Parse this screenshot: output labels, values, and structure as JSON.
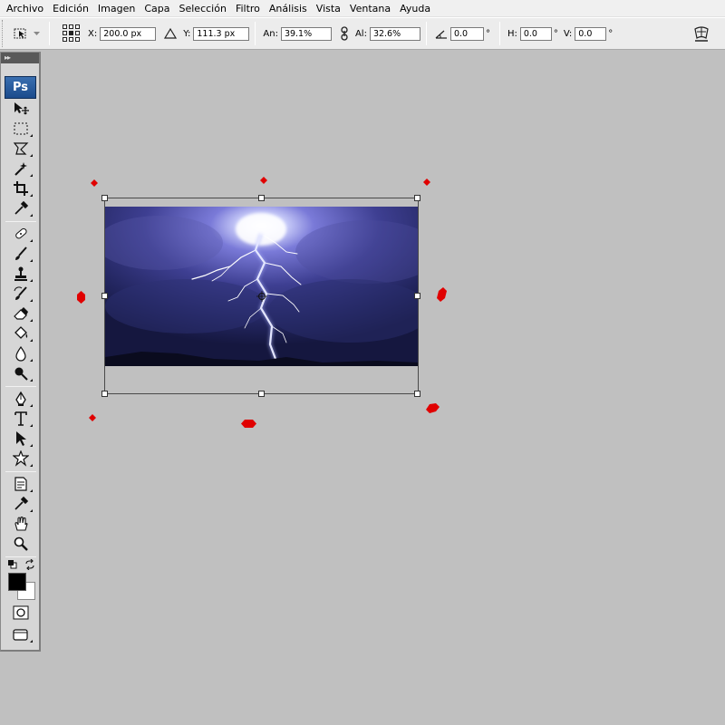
{
  "menu": [
    "Archivo",
    "Edición",
    "Imagen",
    "Capa",
    "Selección",
    "Filtro",
    "Análisis",
    "Vista",
    "Ventana",
    "Ayuda"
  ],
  "options": {
    "x_label": "X:",
    "x_value": "200.0 px",
    "y_label": "Y:",
    "y_value": "111.3 px",
    "width_label": "An:",
    "width_value": "39.1%",
    "height_label": "Al:",
    "height_value": "32.6%",
    "rotation_value": "0.0",
    "rotation_unit": "°",
    "h_skew_label": "H:",
    "h_skew_value": "0.0",
    "h_skew_unit": "°",
    "v_skew_label": "V:",
    "v_skew_value": "0.0",
    "v_skew_unit": "°"
  },
  "toolspanel": {
    "header": "▸▸",
    "logo": "Ps"
  },
  "colors": {
    "foreground": "#000000",
    "background": "#ffffff",
    "marker": "#e00000",
    "canvas_bg": "#c0c0c0"
  },
  "icons": [
    "move-icon",
    "marquee-icon",
    "lasso-icon",
    "magic-wand-icon",
    "crop-icon",
    "eyedropper-icon",
    "healing-brush-icon",
    "brush-icon",
    "clone-stamp-icon",
    "history-brush-icon",
    "eraser-icon",
    "paint-bucket-icon",
    "blur-icon",
    "dodge-icon",
    "pen-icon",
    "type-icon",
    "path-selection-icon",
    "custom-shape-icon",
    "notes-icon",
    "eyedropper-icon",
    "hand-icon",
    "zoom-icon",
    "quick-mask-icon",
    "screen-mode-icon"
  ]
}
